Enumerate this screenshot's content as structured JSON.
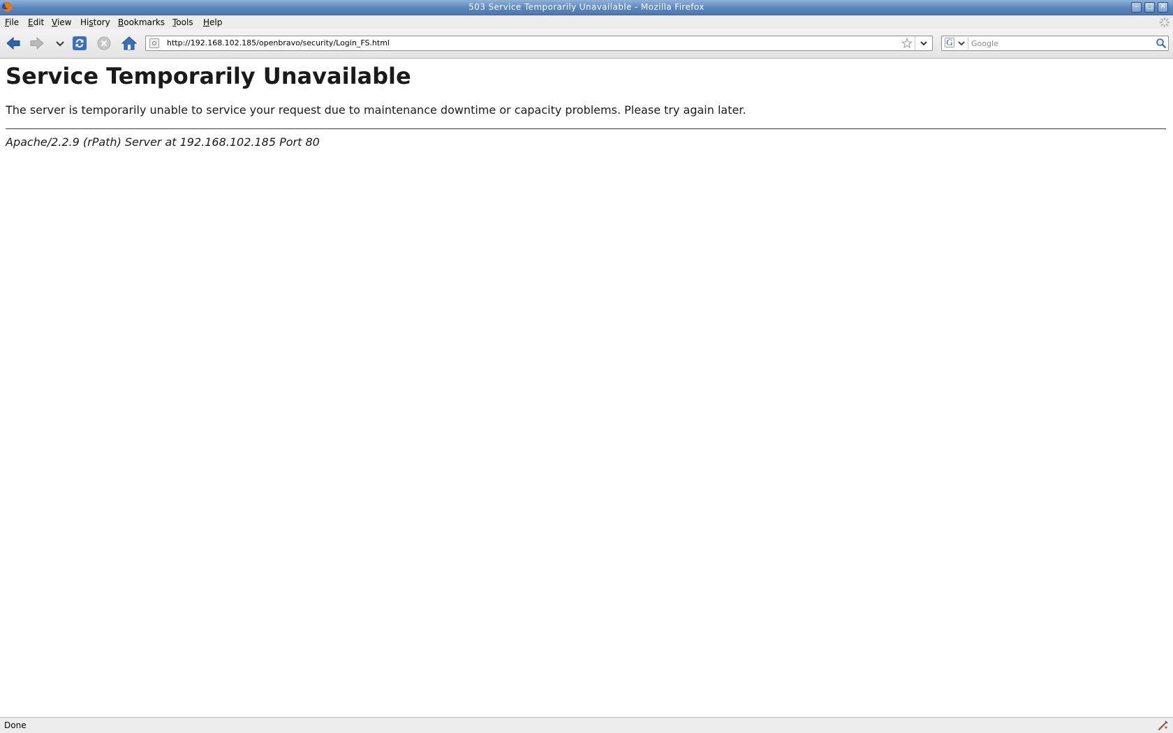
{
  "window": {
    "title": "503 Service Temporarily Unavailable - Mozilla Firefox"
  },
  "menu": {
    "items": [
      {
        "label": "File",
        "mnemonic": "F",
        "rest": "ile"
      },
      {
        "label": "Edit",
        "mnemonic": "E",
        "rest": "dit"
      },
      {
        "label": "View",
        "mnemonic": "V",
        "rest": "iew"
      },
      {
        "label": "History",
        "mnemonic": "s",
        "pre": "Hi",
        "rest": "tory"
      },
      {
        "label": "Bookmarks",
        "mnemonic": "B",
        "rest": "ookmarks"
      },
      {
        "label": "Tools",
        "mnemonic": "T",
        "rest": "ools"
      },
      {
        "label": "Help",
        "mnemonic": "H",
        "rest": "elp"
      }
    ]
  },
  "navigation": {
    "url": "http://192.168.102.185/openbravo/security/Login_FS.html",
    "search_placeholder": "Google",
    "search_engine": "G"
  },
  "page": {
    "heading": "Service Temporarily Unavailable",
    "message": "The server is temporarily unable to service your request due to maintenance downtime or capacity problems. Please try again later.",
    "address": "Apache/2.2.9 (rPath) Server at 192.168.102.185 Port 80"
  },
  "status": {
    "text": "Done"
  },
  "colors": {
    "titlebar": "#5a86bd",
    "nav_icon_blue": "#2f63b0"
  }
}
